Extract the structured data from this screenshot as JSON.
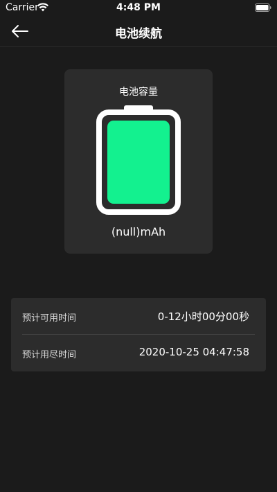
{
  "status_bar": {
    "carrier": "Carrier",
    "time": "4:48 PM",
    "icons": [
      "wifi-icon",
      "battery-icon"
    ]
  },
  "nav": {
    "title": "电池续航",
    "back_icon": "arrow-left-icon"
  },
  "battery": {
    "capacity_label": "电池容量",
    "capacity_value": "(null)mAh",
    "fill_level": 1.0,
    "fill_color": "#13f18f"
  },
  "info": [
    {
      "label": "预计可用时间",
      "value": "0-12小时00分00秒"
    },
    {
      "label": "预计用尽时间",
      "value": "2020-10-25 04:47:58"
    }
  ],
  "colors": {
    "background": "#1b1b1b",
    "card": "#2c2c2c",
    "accent": "#13f18f"
  }
}
